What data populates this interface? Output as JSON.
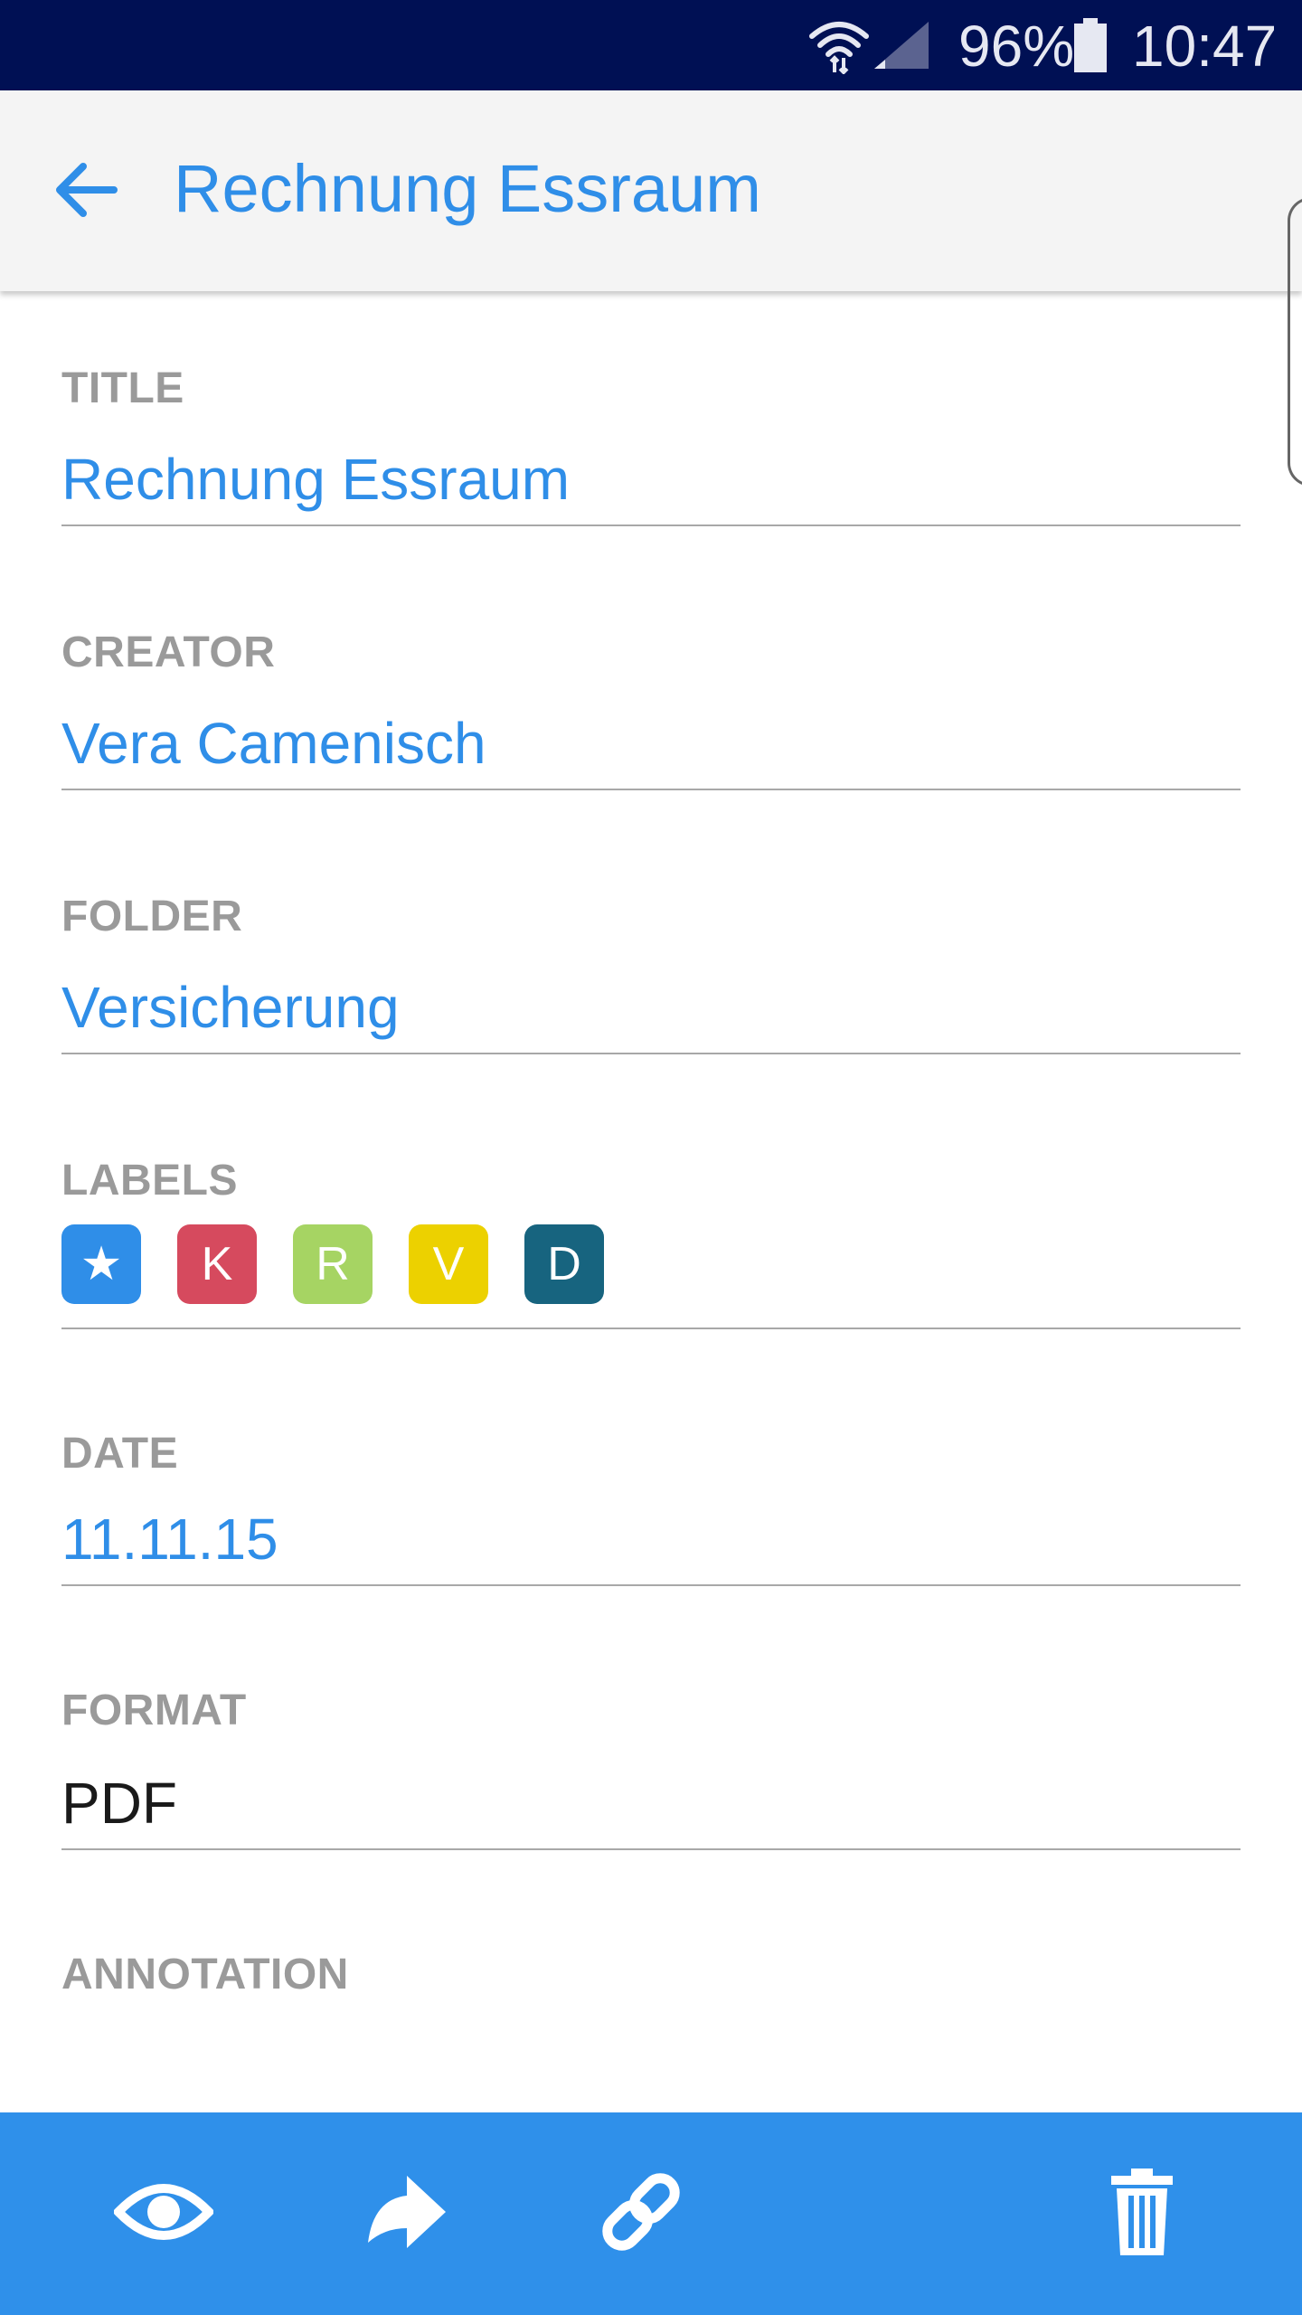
{
  "status_bar": {
    "battery": "96%",
    "time": "10:47"
  },
  "app_bar": {
    "title": "Rechnung Essraum"
  },
  "fields": {
    "title": {
      "label": "TITLE",
      "value": "Rechnung Essraum"
    },
    "creator": {
      "label": "CREATOR",
      "value": "Vera Camenisch"
    },
    "folder": {
      "label": "FOLDER",
      "value": "Versicherung"
    },
    "labels": {
      "label": "LABELS",
      "chips": [
        {
          "text": "★",
          "color": "#2f8ee8"
        },
        {
          "text": "K",
          "color": "#d64a5e"
        },
        {
          "text": "R",
          "color": "#a6d463"
        },
        {
          "text": "V",
          "color": "#ecd100"
        },
        {
          "text": "D",
          "color": "#17647f"
        }
      ]
    },
    "date": {
      "label": "DATE",
      "value": "11.11.15"
    },
    "format": {
      "label": "FORMAT",
      "value": "PDF"
    },
    "annotation": {
      "label": "ANNOTATION",
      "value": ""
    }
  },
  "colors": {
    "status_bar_bg": "#001054",
    "accent": "#2f8ee8",
    "bottom_bar_bg": "#2f90ea",
    "label_gray": "#9a9a9a"
  },
  "actions": [
    {
      "name": "view",
      "icon": "eye-icon"
    },
    {
      "name": "share",
      "icon": "forward-arrow-icon"
    },
    {
      "name": "link",
      "icon": "link-icon"
    },
    {
      "name": "delete",
      "icon": "trash-icon"
    }
  ]
}
